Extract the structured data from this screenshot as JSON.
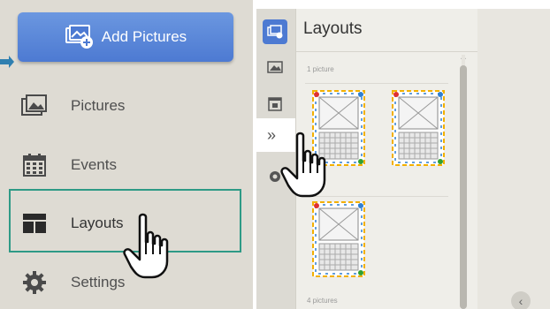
{
  "left": {
    "add_button_label": "Add Pictures",
    "nav": {
      "pictures": "Pictures",
      "events": "Events",
      "layouts": "Layouts",
      "settings": "Settings"
    }
  },
  "right": {
    "panel_title": "Layouts",
    "groups": [
      {
        "label": "1 picture"
      },
      {
        "label": "4 pictures"
      }
    ],
    "collapse_glyph": "‹",
    "expand_glyph": "»"
  },
  "colors": {
    "accent_blue": "#4d7ad2",
    "highlight_teal": "#2e9a86",
    "panel_bg": "#dedbd3"
  },
  "icons": [
    "add-pictures-icon",
    "pictures-icon",
    "events-icon",
    "layouts-icon",
    "settings-icon",
    "pointer-hand-icon",
    "arrow-pointer-icon"
  ]
}
